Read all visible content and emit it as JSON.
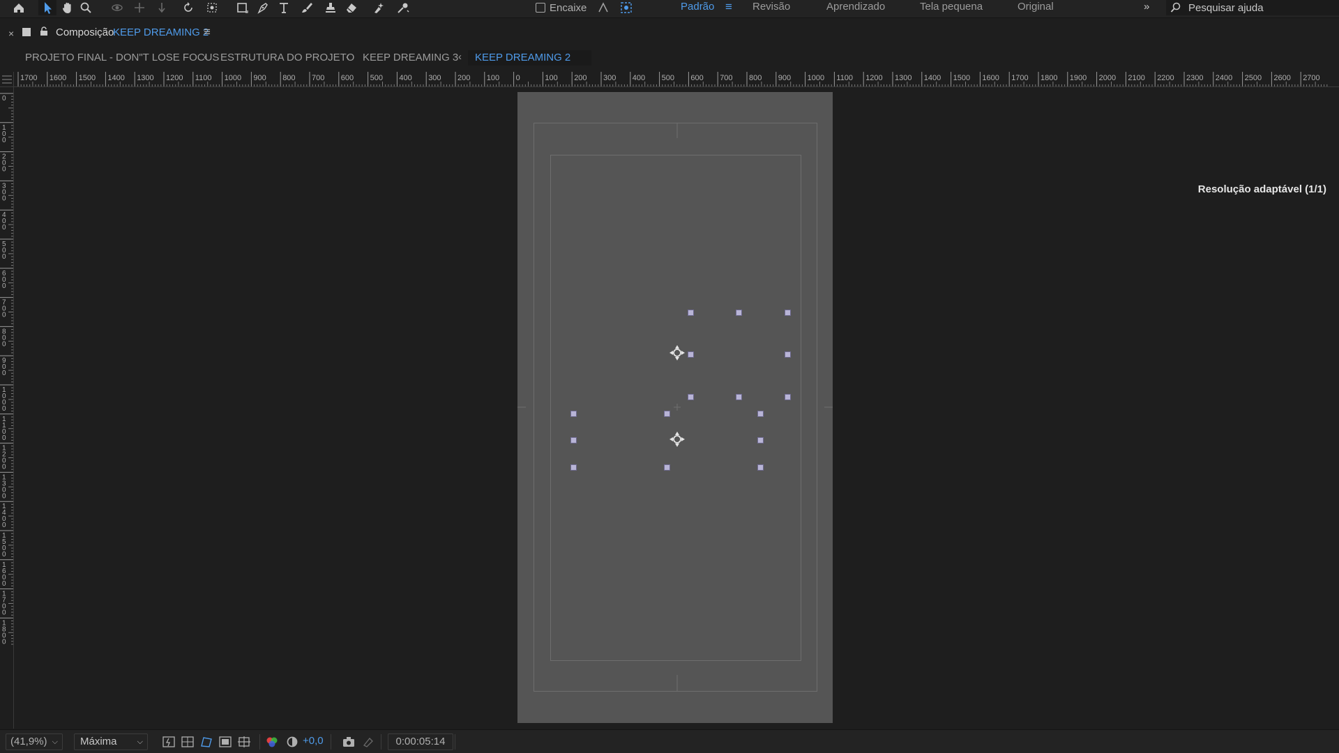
{
  "toolbar": {
    "tools": [
      {
        "name": "home-icon"
      },
      {
        "name": "selection-tool-icon",
        "active": true
      },
      {
        "name": "hand-tool-icon"
      },
      {
        "name": "zoom-tool-icon"
      },
      {
        "name": "orbit-camera-icon"
      },
      {
        "name": "pan-camera-icon"
      },
      {
        "name": "dolly-camera-icon"
      },
      {
        "name": "rotate-tool-icon"
      },
      {
        "name": "pan-behind-tool-icon"
      },
      {
        "name": "rectangle-tool-icon"
      },
      {
        "name": "pen-tool-icon"
      },
      {
        "name": "type-tool-icon"
      },
      {
        "name": "brush-tool-icon"
      },
      {
        "name": "clone-stamp-icon"
      },
      {
        "name": "eraser-tool-icon"
      },
      {
        "name": "roto-brush-icon"
      },
      {
        "name": "puppet-pin-icon"
      }
    ],
    "snap_label": "Encaixe",
    "workspaces": [
      "Padrão",
      "Revisão",
      "Aprendizado",
      "Tela pequena",
      "Original"
    ],
    "active_workspace": "Padrão",
    "search_placeholder": "Pesquisar ajuda"
  },
  "panel": {
    "title": "Composição",
    "comp_name": "KEEP DREAMING 2"
  },
  "breadcrumbs": [
    "PROJETO FINAL - DON\"T LOSE FOCUS",
    "ESTRUTURA DO PROJETO",
    "KEEP DREAMING 3",
    "KEEP DREAMING 2"
  ],
  "ruler": {
    "h_labels": [
      "1700",
      "1600",
      "1500",
      "1400",
      "1300",
      "1200",
      "1100",
      "1000",
      "900",
      "800",
      "700",
      "600",
      "500",
      "400",
      "300",
      "200",
      "100",
      "0",
      "100",
      "200",
      "300",
      "400",
      "500",
      "600",
      "700",
      "800",
      "900",
      "1000",
      "1100",
      "1200",
      "1300",
      "1400",
      "1500",
      "1600",
      "1700",
      "1800",
      "1900",
      "2000",
      "2100",
      "2200",
      "2300",
      "2400",
      "2500",
      "2600",
      "2700"
    ],
    "v_labels": [
      "0",
      "100",
      "200",
      "300",
      "400",
      "500",
      "600",
      "700",
      "800",
      "900",
      "1000",
      "1100",
      "1200",
      "1300",
      "1400",
      "1500",
      "1600",
      "1700",
      "1800"
    ]
  },
  "viewer": {
    "resolution_label": "Resolução adaptável (1/1)"
  },
  "bottom": {
    "zoom": "(41,9%)",
    "resolution": "Máxima",
    "exposure": "+0,0",
    "timecode": "0:00:05:14"
  },
  "colors": {
    "accent": "#4f9bea",
    "background": "#1e1e1e",
    "comp_background": "#555555",
    "handle": "#b8b4d6"
  }
}
